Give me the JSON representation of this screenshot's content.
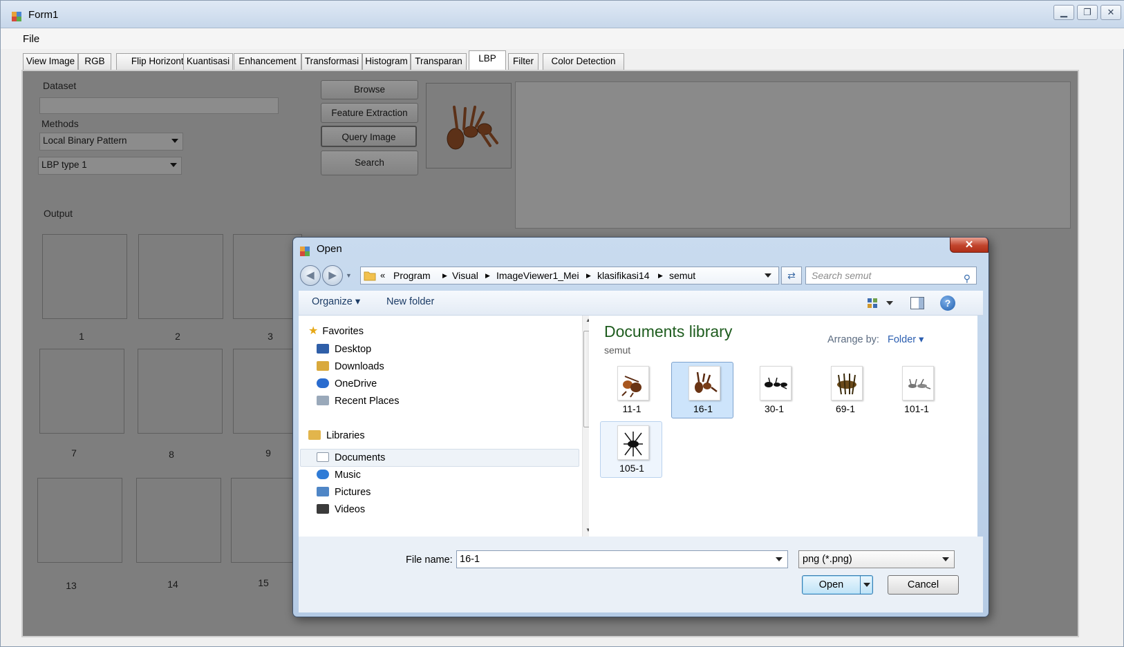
{
  "window": {
    "title": "Form1",
    "menu": [
      "File"
    ]
  },
  "tabs": [
    "View Image",
    "RGB",
    "Flip Horizontal",
    "Kuantisasi",
    "Enhancement",
    "Transformasi",
    "Histogram",
    "Transparan",
    "LBP",
    "Filter",
    "Color Detection"
  ],
  "active_tab": "LBP",
  "form": {
    "dataset_label": "Dataset",
    "dataset_value": "",
    "methods_label": "Methods",
    "method_selected": "Local Binary Pattern",
    "lbp_type_selected": "LBP type 1",
    "buttons": {
      "browse": "Browse",
      "feature_extraction": "Feature Extraction",
      "query_image": "Query Image",
      "search": "Search"
    },
    "output_label": "Output",
    "output_numbers": [
      "1",
      "2",
      "3",
      "7",
      "8",
      "9",
      "13",
      "14",
      "15"
    ]
  },
  "dialog": {
    "title": "Open",
    "close_glyph": "✕",
    "breadcrumb": [
      "Program",
      "Visual",
      "ImageViewer1_Mei",
      "klasifikasi14",
      "semut"
    ],
    "breadcrumb_prefix": "«",
    "search_placeholder": "Search semut",
    "toolbar": {
      "organize": "Organize ▾",
      "new_folder": "New folder"
    },
    "nav": {
      "favorites": "Favorites",
      "favorites_items": [
        "Desktop",
        "Downloads",
        "OneDrive",
        "Recent Places"
      ],
      "libraries": "Libraries",
      "libraries_items": [
        "Documents",
        "Music",
        "Pictures",
        "Videos"
      ],
      "selected": "Documents"
    },
    "library_title": "Documents library",
    "library_subtitle": "semut",
    "arrange_label": "Arrange by:",
    "arrange_value": "Folder ▾",
    "files": [
      "11-1",
      "16-1",
      "30-1",
      "69-1",
      "101-1",
      "105-1"
    ],
    "selected_file": "16-1",
    "file_name_label": "File name:",
    "file_name_value": "16-1",
    "file_type": "png (*.png)",
    "open_button": "Open",
    "cancel_button": "Cancel"
  },
  "colors": {
    "dim_page": "#7e7e7e",
    "library_title": "#1e5c1e",
    "link_blue": "#2b5eb0",
    "close_red": "#c1442c",
    "ant_brown": "#8a4a22"
  },
  "icons": [
    "app-icon",
    "minimize-icon",
    "restore-icon",
    "close-icon",
    "back-icon",
    "forward-icon",
    "folder-icon",
    "refresh-icon",
    "search-icon",
    "views-icon",
    "preview-pane-icon",
    "help-icon",
    "star-icon"
  ]
}
